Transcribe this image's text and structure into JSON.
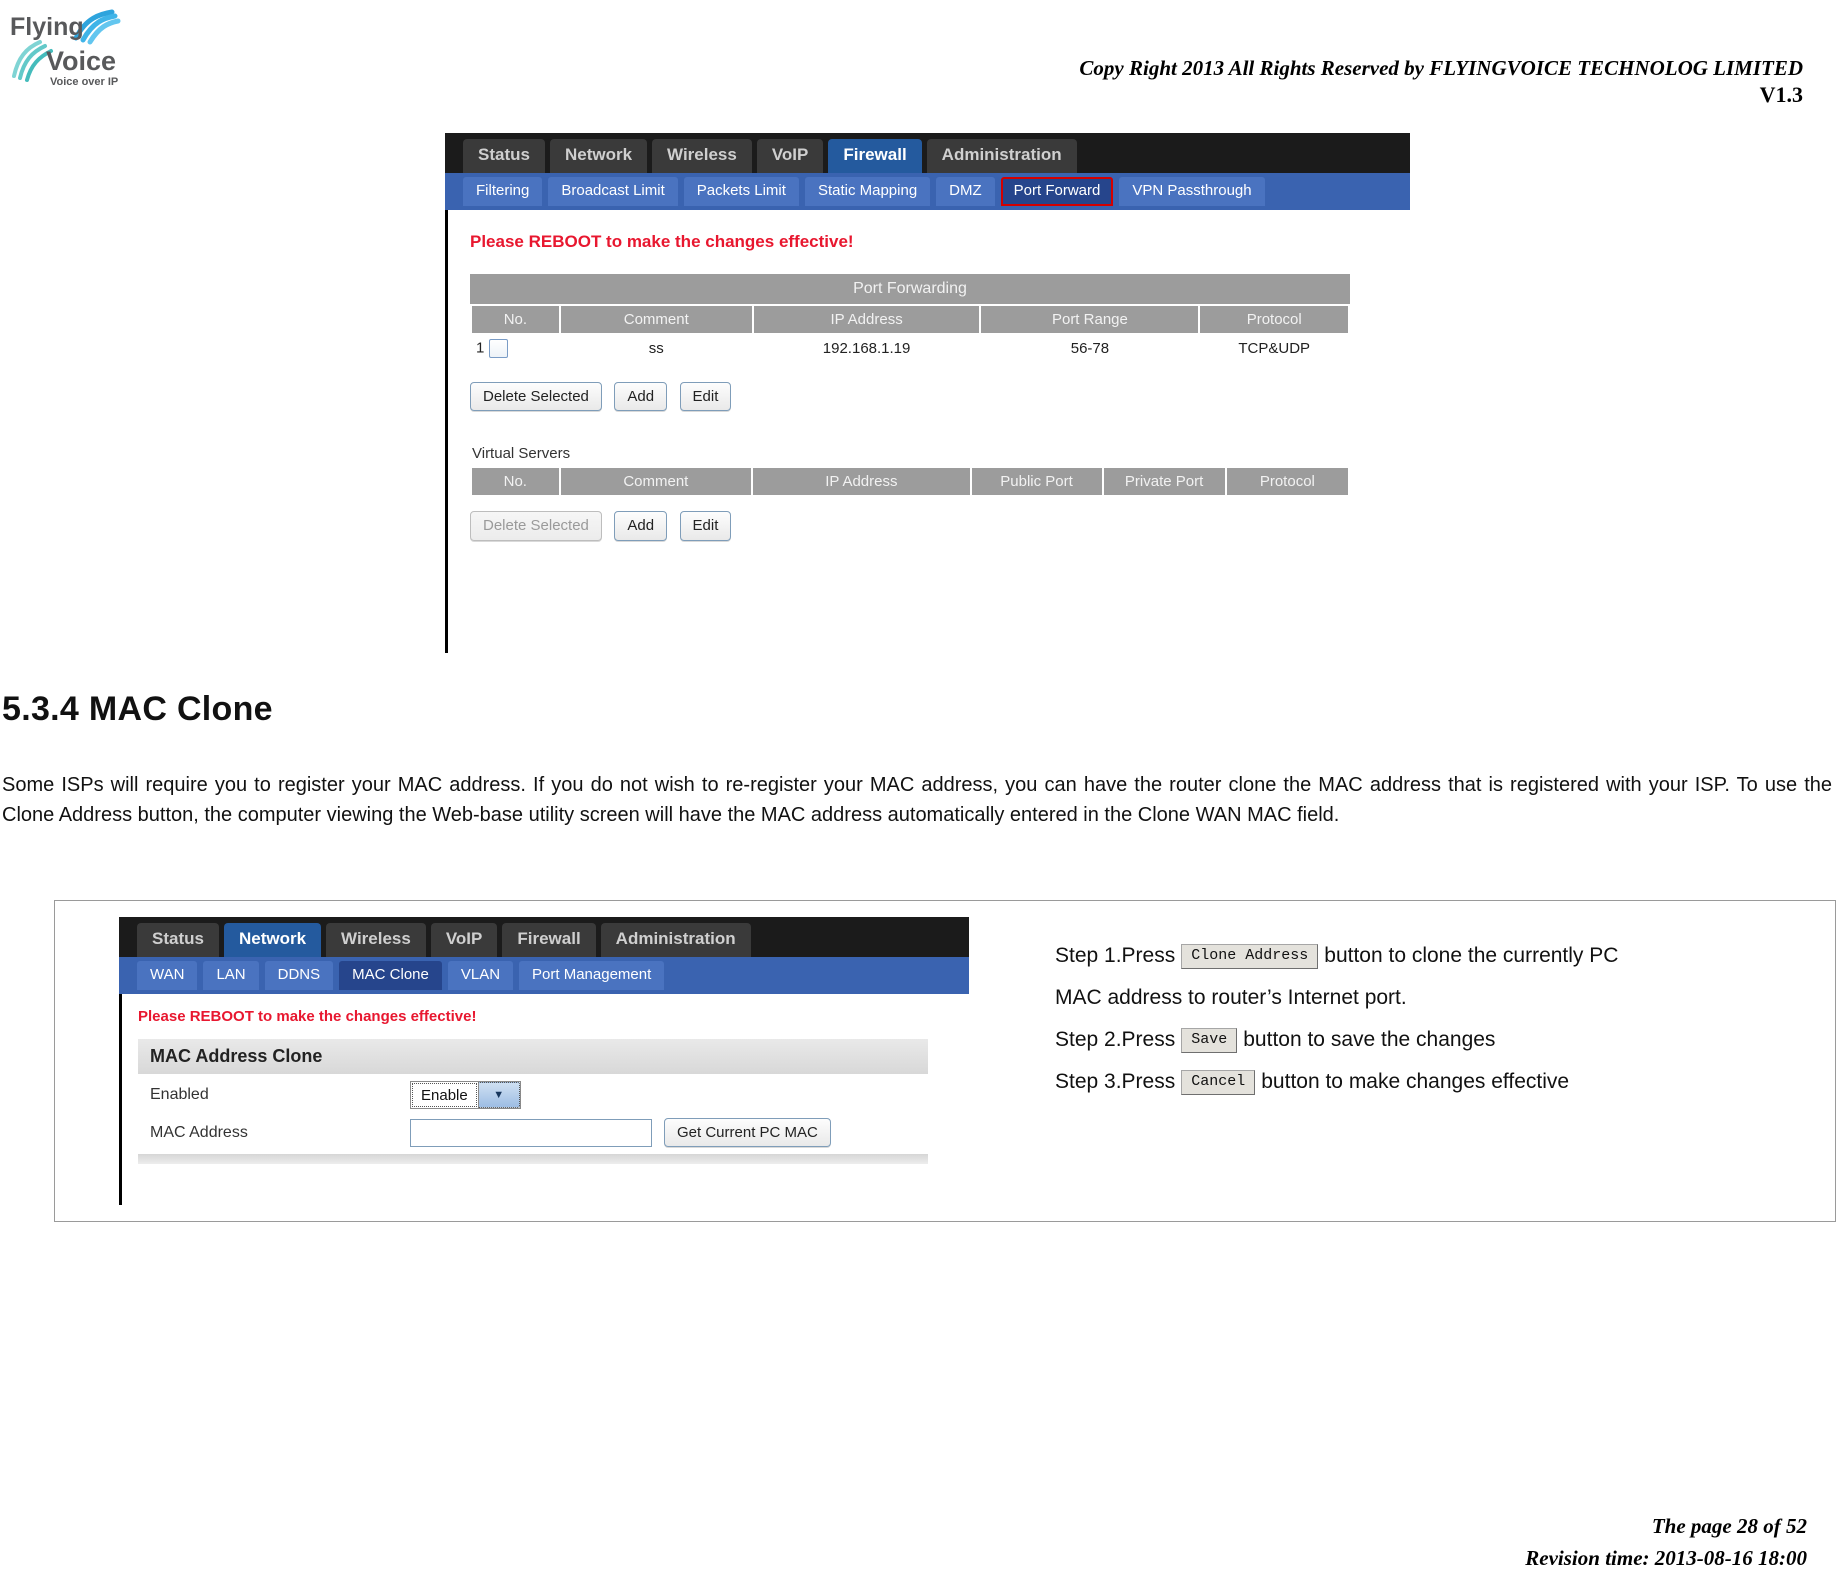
{
  "header": {
    "logo_main": "Flying",
    "logo_second": "Voice",
    "logo_tagline": "Voice over IP",
    "copyright": "Copy Right 2013 All Rights Reserved by FLYINGVOICE TECHNOLOG LIMITED",
    "version": "V1.3"
  },
  "figure_firewall": {
    "main_tabs": [
      {
        "label": "Status",
        "active": false
      },
      {
        "label": "Network",
        "active": false
      },
      {
        "label": "Wireless",
        "active": false
      },
      {
        "label": "VoIP",
        "active": false
      },
      {
        "label": "Firewall",
        "active": true
      },
      {
        "label": "Administration",
        "active": false
      }
    ],
    "sub_tabs": [
      {
        "label": "Filtering",
        "active": false,
        "boxed": false
      },
      {
        "label": "Broadcast Limit",
        "active": false,
        "boxed": false
      },
      {
        "label": "Packets Limit",
        "active": false,
        "boxed": false
      },
      {
        "label": "Static Mapping",
        "active": false,
        "boxed": false
      },
      {
        "label": "DMZ",
        "active": false,
        "boxed": false
      },
      {
        "label": "Port Forward",
        "active": true,
        "boxed": true
      },
      {
        "label": "VPN Passthrough",
        "active": false,
        "boxed": false
      }
    ],
    "reboot_notice": "Please REBOOT to make the changes effective!",
    "port_forwarding": {
      "banner": "Port Forwarding",
      "columns": [
        "No.",
        "Comment",
        "IP Address",
        "Port Range",
        "Protocol"
      ],
      "rows": [
        {
          "no": "1",
          "comment": "ss",
          "ip": "192.168.1.19",
          "port_range": "56-78",
          "protocol": "TCP&UDP"
        }
      ],
      "buttons": {
        "delete": "Delete Selected",
        "add": "Add",
        "edit": "Edit"
      }
    },
    "virtual_servers": {
      "title": "Virtual Servers",
      "columns": [
        "No.",
        "Comment",
        "IP Address",
        "Public Port",
        "Private Port",
        "Protocol"
      ],
      "rows": [],
      "buttons": {
        "delete": "Delete Selected",
        "add": "Add",
        "edit": "Edit"
      }
    }
  },
  "section": {
    "heading": "5.3.4 MAC Clone",
    "paragraph": "Some ISPs will require you to register your MAC address. If you do not wish to re-register your MAC address, you can have the router clone the MAC address that is registered with your ISP. To use the Clone Address button, the computer viewing the Web-base utility screen will have the MAC address automatically entered in the Clone WAN MAC field."
  },
  "figure_macclone": {
    "main_tabs": [
      {
        "label": "Status",
        "active": false
      },
      {
        "label": "Network",
        "active": true
      },
      {
        "label": "Wireless",
        "active": false
      },
      {
        "label": "VoIP",
        "active": false
      },
      {
        "label": "Firewall",
        "active": false
      },
      {
        "label": "Administration",
        "active": false
      }
    ],
    "sub_tabs": [
      {
        "label": "WAN",
        "active": false
      },
      {
        "label": "LAN",
        "active": false
      },
      {
        "label": "DDNS",
        "active": false
      },
      {
        "label": "MAC Clone",
        "active": true
      },
      {
        "label": "VLAN",
        "active": false
      },
      {
        "label": "Port Management",
        "active": false
      }
    ],
    "reboot_notice": "Please REBOOT to make the changes effective!",
    "form_title": "MAC Address Clone",
    "enabled_label": "Enabled",
    "enabled_value": "Enable",
    "mac_label": "MAC Address",
    "mac_value": "",
    "get_mac_button": "Get Current PC MAC"
  },
  "steps": [
    {
      "prefix": "Step 1.Press",
      "button": "Clone Address",
      "suffix": "button to clone the currently PC"
    },
    {
      "continuation": "MAC address to router’s Internet port."
    },
    {
      "prefix": "Step 2.Press",
      "button": "Save",
      "suffix": "button to save the changes"
    },
    {
      "prefix": "Step 3.Press",
      "button": "Cancel",
      "suffix": "button to make changes effective"
    }
  ],
  "footer": {
    "page": "The page 28 of 52",
    "revision": "Revision time: 2013-08-16 18:00"
  }
}
